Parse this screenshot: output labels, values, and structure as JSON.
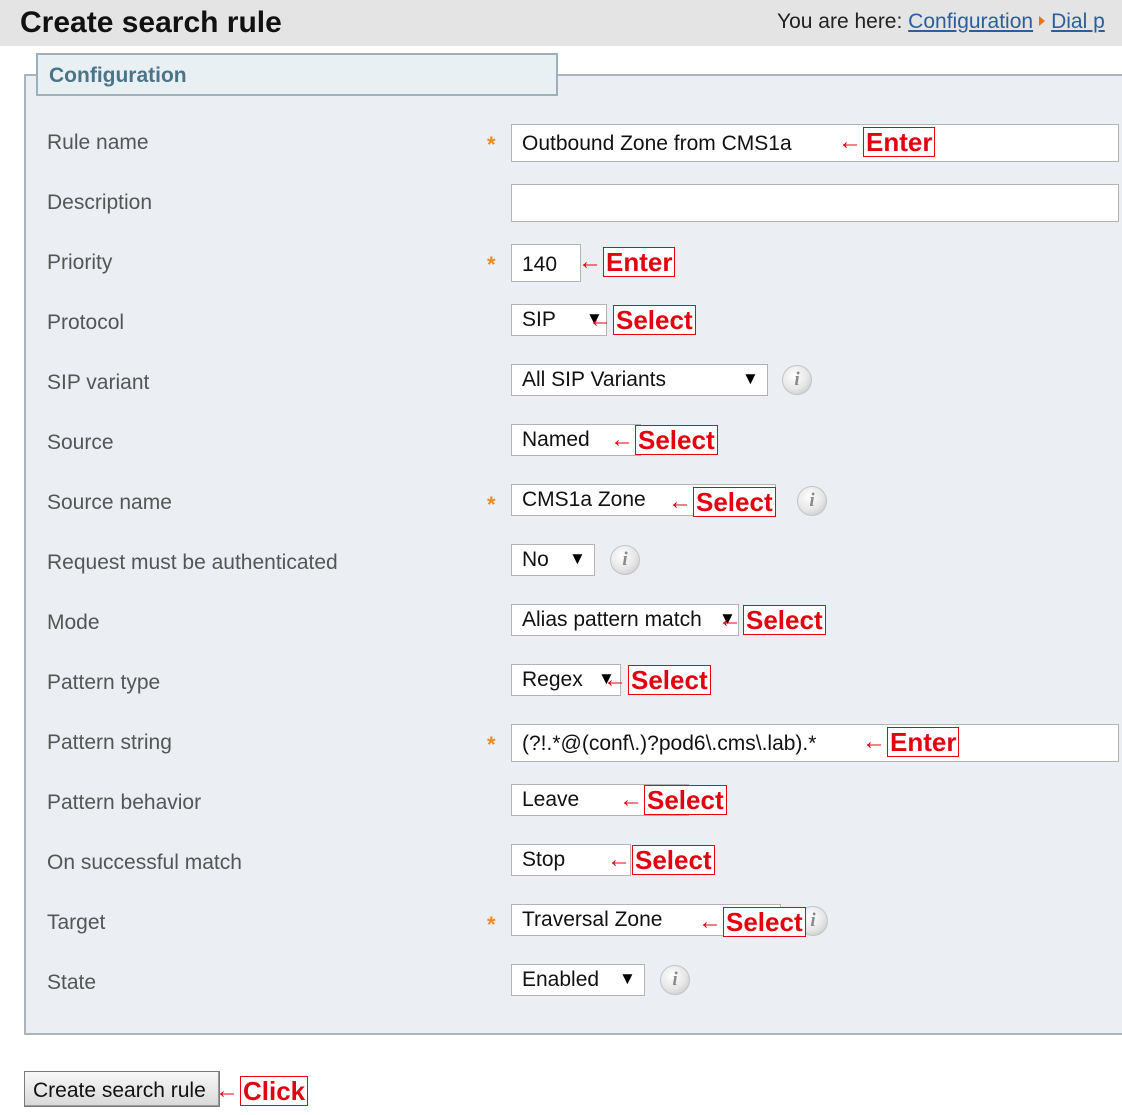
{
  "header": {
    "title": "Create search rule",
    "breadcrumb_prefix": "You are here:",
    "crumbs": [
      "Configuration",
      "Dial p"
    ]
  },
  "section": {
    "legend": "Configuration"
  },
  "fields": {
    "rule_name": {
      "label": "Rule name",
      "value": "Outbound Zone from CMS1a"
    },
    "description": {
      "label": "Description",
      "value": ""
    },
    "priority": {
      "label": "Priority",
      "value": "140"
    },
    "protocol": {
      "label": "Protocol",
      "value": "SIP"
    },
    "sip_variant": {
      "label": "SIP variant",
      "value": "All SIP Variants"
    },
    "source": {
      "label": "Source",
      "value": "Named"
    },
    "source_name": {
      "label": "Source name",
      "value": "CMS1a Zone"
    },
    "auth": {
      "label": "Request must be authenticated",
      "value": "No"
    },
    "mode": {
      "label": "Mode",
      "value": "Alias pattern match"
    },
    "pattern_type": {
      "label": "Pattern type",
      "value": "Regex"
    },
    "pattern_string": {
      "label": "Pattern string",
      "value": "(?!.*@(conf\\.)?pod6\\.cms\\.lab).*"
    },
    "pattern_behavior": {
      "label": "Pattern behavior",
      "value": "Leave"
    },
    "on_match": {
      "label": "On successful match",
      "value": "Stop"
    },
    "target": {
      "label": "Target",
      "value": "Traversal Zone"
    },
    "state": {
      "label": "State",
      "value": "Enabled"
    }
  },
  "required_marker": "*",
  "annotations": {
    "arrow": "←",
    "enter": "Enter",
    "select": "Select",
    "click": "Click"
  },
  "submit_label": "Create search rule",
  "dropdown_arrow": "▼",
  "info_glyph": "i",
  "colors": {
    "annotation_red": "#e3000f",
    "required_orange": "#f08a1d",
    "link_blue": "#2e5e9a",
    "panel_bg": "#ebeff3",
    "legend_text": "#4b7488"
  }
}
